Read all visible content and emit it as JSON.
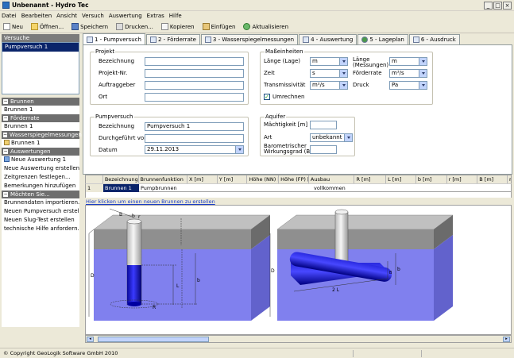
{
  "window": {
    "title": "Unbenannt - Hydro Tec"
  },
  "menu": [
    "Datei",
    "Bearbeiten",
    "Ansicht",
    "Versuch",
    "Auswertung",
    "Extras",
    "Hilfe"
  ],
  "toolbar": {
    "new": "Neu",
    "open": "Öffnen...",
    "save": "Speichern",
    "print": "Drucken...",
    "copy": "Kopieren",
    "paste": "Einfügen",
    "refresh": "Aktualisieren"
  },
  "sidebar": {
    "versuche_header": "Versuche",
    "versuche_items": [
      "Pumpversuch 1"
    ],
    "sections": [
      {
        "title": "Brunnen",
        "items": [
          "Brunnen 1"
        ]
      },
      {
        "title": "Förderrate",
        "items": [
          "Brunnen 1"
        ]
      },
      {
        "title": "Wasserspiegelmessungen",
        "items": [
          "Brunnen 1"
        ]
      },
      {
        "title": "Auswertungen",
        "items": [
          "Neue Auswertung 1",
          "Neue Auswertung erstellen",
          "Zeitgrenzen festlegen...",
          "Bemerkungen hinzufügen"
        ]
      },
      {
        "title": "Möchten Sie...",
        "items": [
          "Brunnendaten importieren...",
          "Neuen Pumpversuch erstellen",
          "Neuen Slug-Test erstellen",
          "technische Hilfe anfordern..."
        ]
      }
    ]
  },
  "tabs": [
    "1 - Pumpversuch",
    "2 - Förderrate",
    "3 - Wasserspiegelmessungen",
    "4 - Auswertung",
    "5 - Lageplan",
    "6 - Ausdruck"
  ],
  "projekt": {
    "title": "Projekt",
    "fields": [
      {
        "label": "Bezeichnung",
        "value": ""
      },
      {
        "label": "Projekt-Nr.",
        "value": ""
      },
      {
        "label": "Auftraggeber",
        "value": ""
      },
      {
        "label": "Ort",
        "value": ""
      }
    ]
  },
  "masseinheiten": {
    "title": "Maßeinheiten",
    "laenge_lage": {
      "label": "Länge (Lage)",
      "value": "m"
    },
    "zeit": {
      "label": "Zeit",
      "value": "s"
    },
    "transmissivitaet": {
      "label": "Transmissivität",
      "value": "m²/s"
    },
    "laenge_messungen": {
      "label": "Länge (Messungen)",
      "value": "m"
    },
    "foerderrate": {
      "label": "Förderrate",
      "value": "m³/s"
    },
    "druck": {
      "label": "Druck",
      "value": "Pa"
    },
    "umrechnen": {
      "label": "Umrechnen",
      "checked": "✓"
    }
  },
  "pumpversuch": {
    "title": "Pumpversuch",
    "bezeichnung": {
      "label": "Bezeichnung",
      "value": "Pumpversuch 1"
    },
    "durchgefuehrt": {
      "label": "Durchgeführt von",
      "value": ""
    },
    "datum": {
      "label": "Datum",
      "value": "29.11.2013"
    }
  },
  "aquifer": {
    "title": "Aquifer",
    "maechtigkeit": {
      "label": "Mächtigkeit [m]",
      "value": ""
    },
    "art": {
      "label": "Art",
      "value": "unbekannt"
    },
    "wirkungsgrad": {
      "label1": "Barometrischer",
      "label2": "Wirkungsgrad (BE)",
      "value": ""
    }
  },
  "grid": {
    "headers": [
      "",
      "Bezeichnung",
      "Brunnenfunktion",
      "X [m]",
      "Y [m]",
      "Höhe (NN) [r",
      "Höhe (FP) [r",
      "Ausbau",
      "R [m]",
      "L [m]",
      "b [m]",
      "r [m]",
      "B [m]",
      "n"
    ],
    "rows": [
      [
        "1",
        "Brunnen 1",
        "Pumpbrunnen",
        "",
        "",
        "",
        "",
        "vollkommen",
        "",
        "",
        "",
        "",
        "",
        ""
      ]
    ]
  },
  "link_text": "Hier klicken um einen neuen Brunnen zu erstellen",
  "diagram": {
    "left_labels": {
      "B": "B",
      "b": "b",
      "r": "r",
      "D": "D",
      "L": "L",
      "b2": "b",
      "R": "R"
    },
    "right_labels": {
      "D": "D",
      "b": "b",
      "B": "B",
      "L": "2 L"
    }
  },
  "status": {
    "text": "© Copyright GeoLogik Software GmbH 2010"
  }
}
